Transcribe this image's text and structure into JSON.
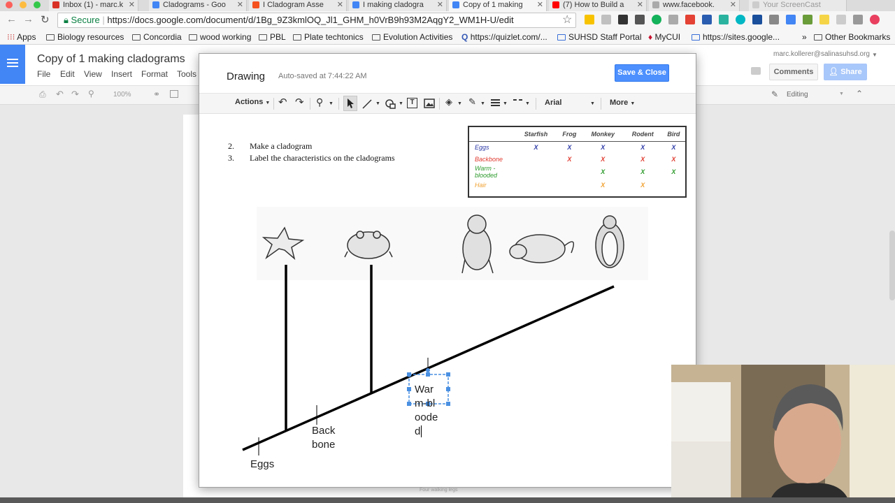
{
  "browser": {
    "tabs": [
      {
        "label": "Inbox (1) - marc.k",
        "color": "#d93025"
      },
      {
        "label": "Cladograms - Goo",
        "color": "#4285f4"
      },
      {
        "label": "I Cladogram Asse",
        "color": "#f4511e"
      },
      {
        "label": "I making cladogra",
        "color": "#4285f4"
      },
      {
        "label": "Copy of 1 making",
        "color": "#4285f4"
      },
      {
        "label": "(7) How to Build a",
        "color": "#ff0000"
      },
      {
        "label": "www.facebook.",
        "color": "#aaaaaa"
      },
      {
        "label": "Your ScreenCast",
        "color": "#aaaaaa"
      }
    ],
    "secure_label": "Secure",
    "url": "https://docs.google.com/document/d/1Bg_9Z3kmlOQ_Jl1_GHM_h0VrB9h93M2AqgY2_WM1H-U/edit",
    "bookmarks": {
      "apps": "Apps",
      "items": [
        "Biology resources",
        "Concordia",
        "wood working",
        "PBL",
        "Plate techtonics",
        "Evolution Activities",
        "https://quizlet.com/...",
        "SUHSD Staff Portal",
        "MyCUI",
        "https://sites.google..."
      ],
      "overflow": "»",
      "other": "Other Bookmarks"
    }
  },
  "docs": {
    "title": "Copy of 1 making cladograms",
    "menu": [
      "File",
      "Edit",
      "View",
      "Insert",
      "Format",
      "Tools"
    ],
    "zoom": "100%",
    "account": "marc.kollerer@salinasuhsd.org",
    "comments_label": "Comments",
    "share_label": "Share",
    "mode_label": "Editing"
  },
  "drawing": {
    "title": "Drawing",
    "saved_status": "Auto-saved at 7:44:22 AM",
    "save_close_label": "Save & Close",
    "toolbar": {
      "actions_label": "Actions",
      "font_name": "Arial",
      "more_label": "More"
    },
    "instructions": [
      {
        "num": "2.",
        "text": "Make a cladogram"
      },
      {
        "num": "3.",
        "text": "Label the characteristics on the cladograms"
      }
    ],
    "table": {
      "columns": [
        "Starfish",
        "Frog",
        "Monkey",
        "Rodent",
        "Bird"
      ],
      "rows": [
        {
          "label": "Eggs",
          "color": "#2b39a6",
          "marks": [
            "X",
            "X",
            "X",
            "X",
            "X"
          ]
        },
        {
          "label": "Backbone",
          "color": "#e03a2f",
          "marks": [
            "",
            "X",
            "X",
            "X",
            "X"
          ]
        },
        {
          "label": "Warm -blooded",
          "color": "#2c9a2c",
          "marks": [
            "",
            "",
            "X",
            "X",
            "X"
          ]
        },
        {
          "label": "Hair",
          "color": "#f0a030",
          "marks": [
            "",
            "",
            "X",
            "X",
            ""
          ]
        }
      ]
    },
    "labels": {
      "eggs": "Eggs",
      "backbone_1": "Back",
      "backbone_2": "bone",
      "warm_1": "War",
      "warm_2": "m-bl",
      "warm_3": "oode",
      "warm_4": "d"
    },
    "ruler_text": "Four walking legs"
  }
}
